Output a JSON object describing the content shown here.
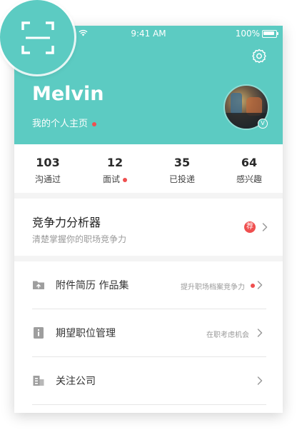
{
  "status_bar": {
    "time": "9:41 AM",
    "battery": "100%"
  },
  "profile": {
    "name": "Melvin",
    "homepage_link": "我的个人主页",
    "verified_badge": "V"
  },
  "stats": [
    {
      "value": "103",
      "label": "沟通过",
      "dot": false
    },
    {
      "value": "12",
      "label": "面试",
      "dot": true
    },
    {
      "value": "35",
      "label": "已投递",
      "dot": false
    },
    {
      "value": "64",
      "label": "感兴趣",
      "dot": false
    }
  ],
  "analyzer": {
    "title": "竞争力分析器",
    "subtitle": "清楚掌握你的职场竞争力",
    "badge": "荐"
  },
  "menu": [
    {
      "icon": "folder-upload-icon",
      "label": "附件简历 作品集",
      "hint": "提升职场档案竞争力",
      "dot": true
    },
    {
      "icon": "info-card-icon",
      "label": "期望职位管理",
      "hint": "在职考虑机会",
      "dot": false
    },
    {
      "icon": "building-icon",
      "label": "关注公司",
      "hint": "",
      "dot": false
    }
  ],
  "colors": {
    "accent": "#5ccbc2",
    "dot": "#ef4f4f"
  },
  "icons": {
    "scan": "scan-icon",
    "settings": "gear-icon",
    "chevron": "chevron-right-icon",
    "wifi": "wifi-icon"
  }
}
